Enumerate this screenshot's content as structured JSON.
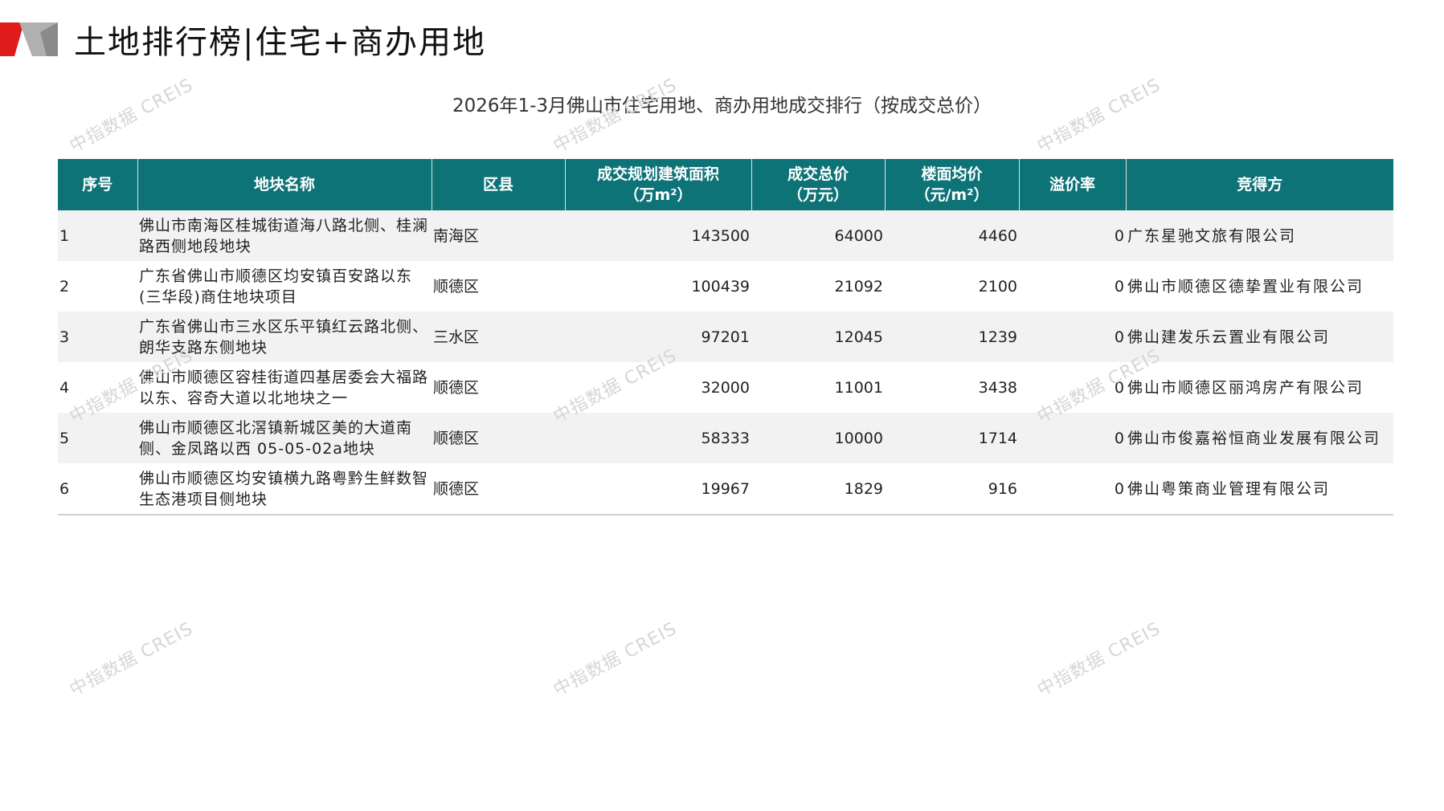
{
  "page": {
    "title": "土地排行榜|住宅+商办用地",
    "subtitle": "2026年1-3月佛山市住宅用地、商办用地成交排行（按成交总价）",
    "watermark": "中指数据 CREIS"
  },
  "colors": {
    "header_bg": "#0e7377",
    "price_red": "#c00000",
    "logo_red": "#e01b1b",
    "logo_gray": "#9a9a9a"
  },
  "table": {
    "headers": {
      "rank": "序号",
      "name": "地块名称",
      "district": "区县",
      "area_line1": "成交规划建筑面积",
      "area_line2": "（万m²）",
      "total_line1": "成交总价",
      "total_line2": "（万元）",
      "unit_line1": "楼面均价",
      "unit_line2": "（元/m²）",
      "premium": "溢价率",
      "buyer": "竞得方"
    },
    "rows": [
      {
        "rank": "1",
        "name": "佛山市南海区桂城街道海八路北侧、桂澜路西侧地段地块",
        "district": "南海区",
        "area": "143500",
        "total": "64000",
        "unit": "4460",
        "premium": "0",
        "buyer": "广东星驰文旅有限公司"
      },
      {
        "rank": "2",
        "name": "广东省佛山市顺德区均安镇百安路以东(三华段)商住地块项目",
        "district": "顺德区",
        "area": "100439",
        "total": "21092",
        "unit": "2100",
        "premium": "0",
        "buyer": "佛山市顺德区德挚置业有限公司"
      },
      {
        "rank": "3",
        "name": "广东省佛山市三水区乐平镇红云路北侧、朗华支路东侧地块",
        "district": "三水区",
        "area": "97201",
        "total": "12045",
        "unit": "1239",
        "premium": "0",
        "buyer": "佛山建发乐云置业有限公司"
      },
      {
        "rank": "4",
        "name": "佛山市顺德区容桂街道四基居委会大福路以东、容奇大道以北地块之一",
        "district": "顺德区",
        "area": "32000",
        "total": "11001",
        "unit": "3438",
        "premium": "0",
        "buyer": "佛山市顺德区丽鸿房产有限公司"
      },
      {
        "rank": "5",
        "name": "佛山市顺德区北滘镇新城区美的大道南侧、金凤路以西 05-05-02a地块",
        "district": "顺德区",
        "area": "58333",
        "total": "10000",
        "unit": "1714",
        "premium": "0",
        "buyer": "佛山市俊嘉裕恒商业发展有限公司"
      },
      {
        "rank": "6",
        "name": "佛山市顺德区均安镇横九路粤黔生鲜数智生态港项目侧地块",
        "district": "顺德区",
        "area": "19967",
        "total": "1829",
        "unit": "916",
        "premium": "0",
        "buyer": "佛山粤策商业管理有限公司"
      }
    ]
  }
}
